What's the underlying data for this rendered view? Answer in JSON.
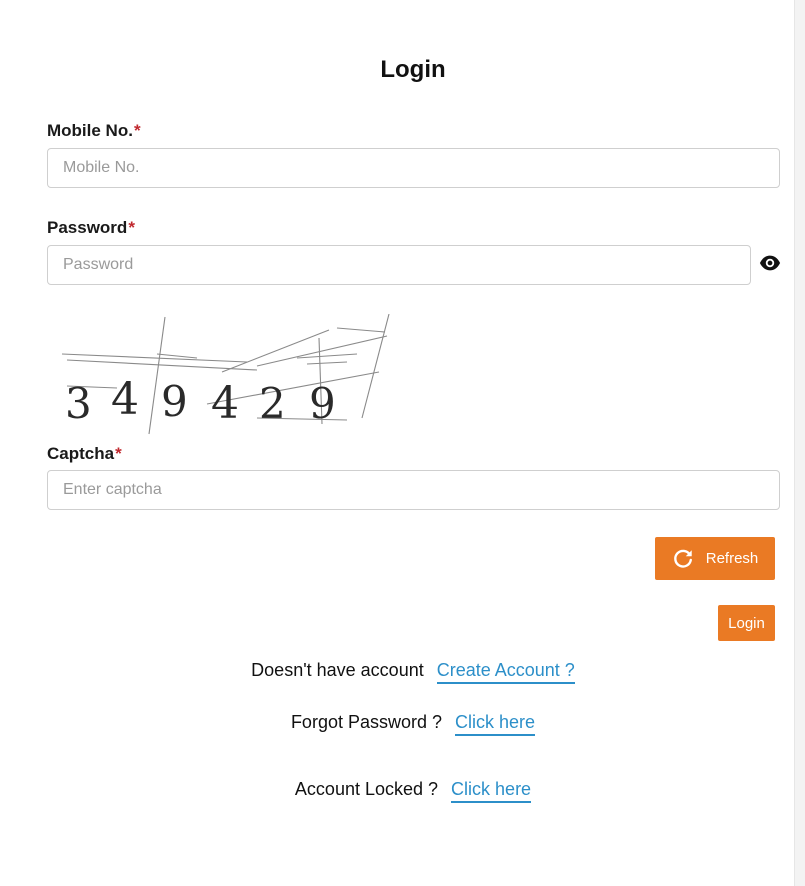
{
  "title": "Login",
  "mobile": {
    "label": "Mobile No.",
    "required_mark": "*",
    "placeholder": "Mobile No.",
    "value": ""
  },
  "password": {
    "label": "Password",
    "required_mark": "*",
    "placeholder": "Password",
    "value": "",
    "toggle_icon": "eye-icon"
  },
  "captcha_image": {
    "digits": [
      "3",
      "4",
      "9",
      "4",
      "2",
      "9"
    ]
  },
  "captcha": {
    "label": "Captcha",
    "required_mark": "*",
    "placeholder": "Enter captcha",
    "value": ""
  },
  "buttons": {
    "refresh_label": "Refresh",
    "refresh_icon": "refresh-icon",
    "login_label": "Login"
  },
  "links": {
    "create_account_lead": "Doesn't have account",
    "create_account_link": "Create Account ?",
    "forgot_password_lead": "Forgot Password ?",
    "forgot_password_link": "Click here",
    "account_locked_lead": "Account Locked ?",
    "account_locked_link": "Click here"
  },
  "colors": {
    "accent": "#ea7a24",
    "link": "#2c8fc9",
    "required": "#c0282e"
  }
}
